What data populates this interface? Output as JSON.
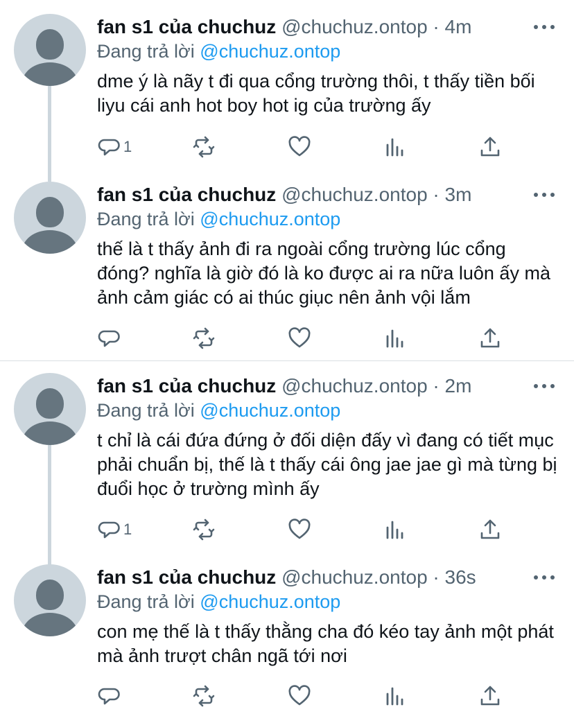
{
  "tweets": [
    {
      "name": "fan s1 của chuchuz",
      "handle": "@chuchuz.ontop",
      "dot": "·",
      "time": "4m",
      "reply_prefix": "Đang trả lời",
      "reply_mention": "@chuchuz.ontop",
      "text": "dme ý là nãy t đi qua cổng trường thôi, t thấy tiền bối liyu cái anh hot boy hot ig của trường ấy",
      "reply_count": "1"
    },
    {
      "name": "fan s1 của chuchuz",
      "handle": "@chuchuz.ontop",
      "dot": "·",
      "time": "3m",
      "reply_prefix": "Đang trả lời",
      "reply_mention": "@chuchuz.ontop",
      "text": "thế là t thấy ảnh đi ra ngoài cổng trường lúc cổng đóng? nghĩa là giờ đó là ko được ai ra nữa luôn ấy mà ảnh cảm giác có ai thúc giục nên ảnh vội lắm",
      "reply_count": ""
    },
    {
      "name": "fan s1 của chuchuz",
      "handle": "@chuchuz.ontop",
      "dot": "·",
      "time": "2m",
      "reply_prefix": "Đang trả lời",
      "reply_mention": "@chuchuz.ontop",
      "text": "t chỉ là cái đứa đứng ở đối diện đấy vì đang có tiết mục phải chuẩn bị, thế là t thấy cái ông jae jae gì mà từng bị đuổi học ở trường mình ấy",
      "reply_count": "1"
    },
    {
      "name": "fan s1 của chuchuz",
      "handle": "@chuchuz.ontop",
      "dot": "·",
      "time": "36s",
      "reply_prefix": "Đang trả lời",
      "reply_mention": "@chuchuz.ontop",
      "text": "con mẹ thế là t thấy thằng cha đó kéo tay ảnh một phát mà ảnh trượt chân ngã tới nơi",
      "reply_count": ""
    }
  ],
  "icons": {
    "reply": "comment-icon",
    "retweet": "retweet-icon",
    "like": "heart-icon",
    "analytics": "analytics-icon",
    "share": "share-icon",
    "more": "more-dots-icon"
  },
  "colors": {
    "text": "#0f1419",
    "secondary": "#536471",
    "mention": "#1d9bf0",
    "avatar_bg": "#ccd6dd",
    "avatar_fg": "#66757f",
    "thread_line": "#ccd6dd"
  }
}
